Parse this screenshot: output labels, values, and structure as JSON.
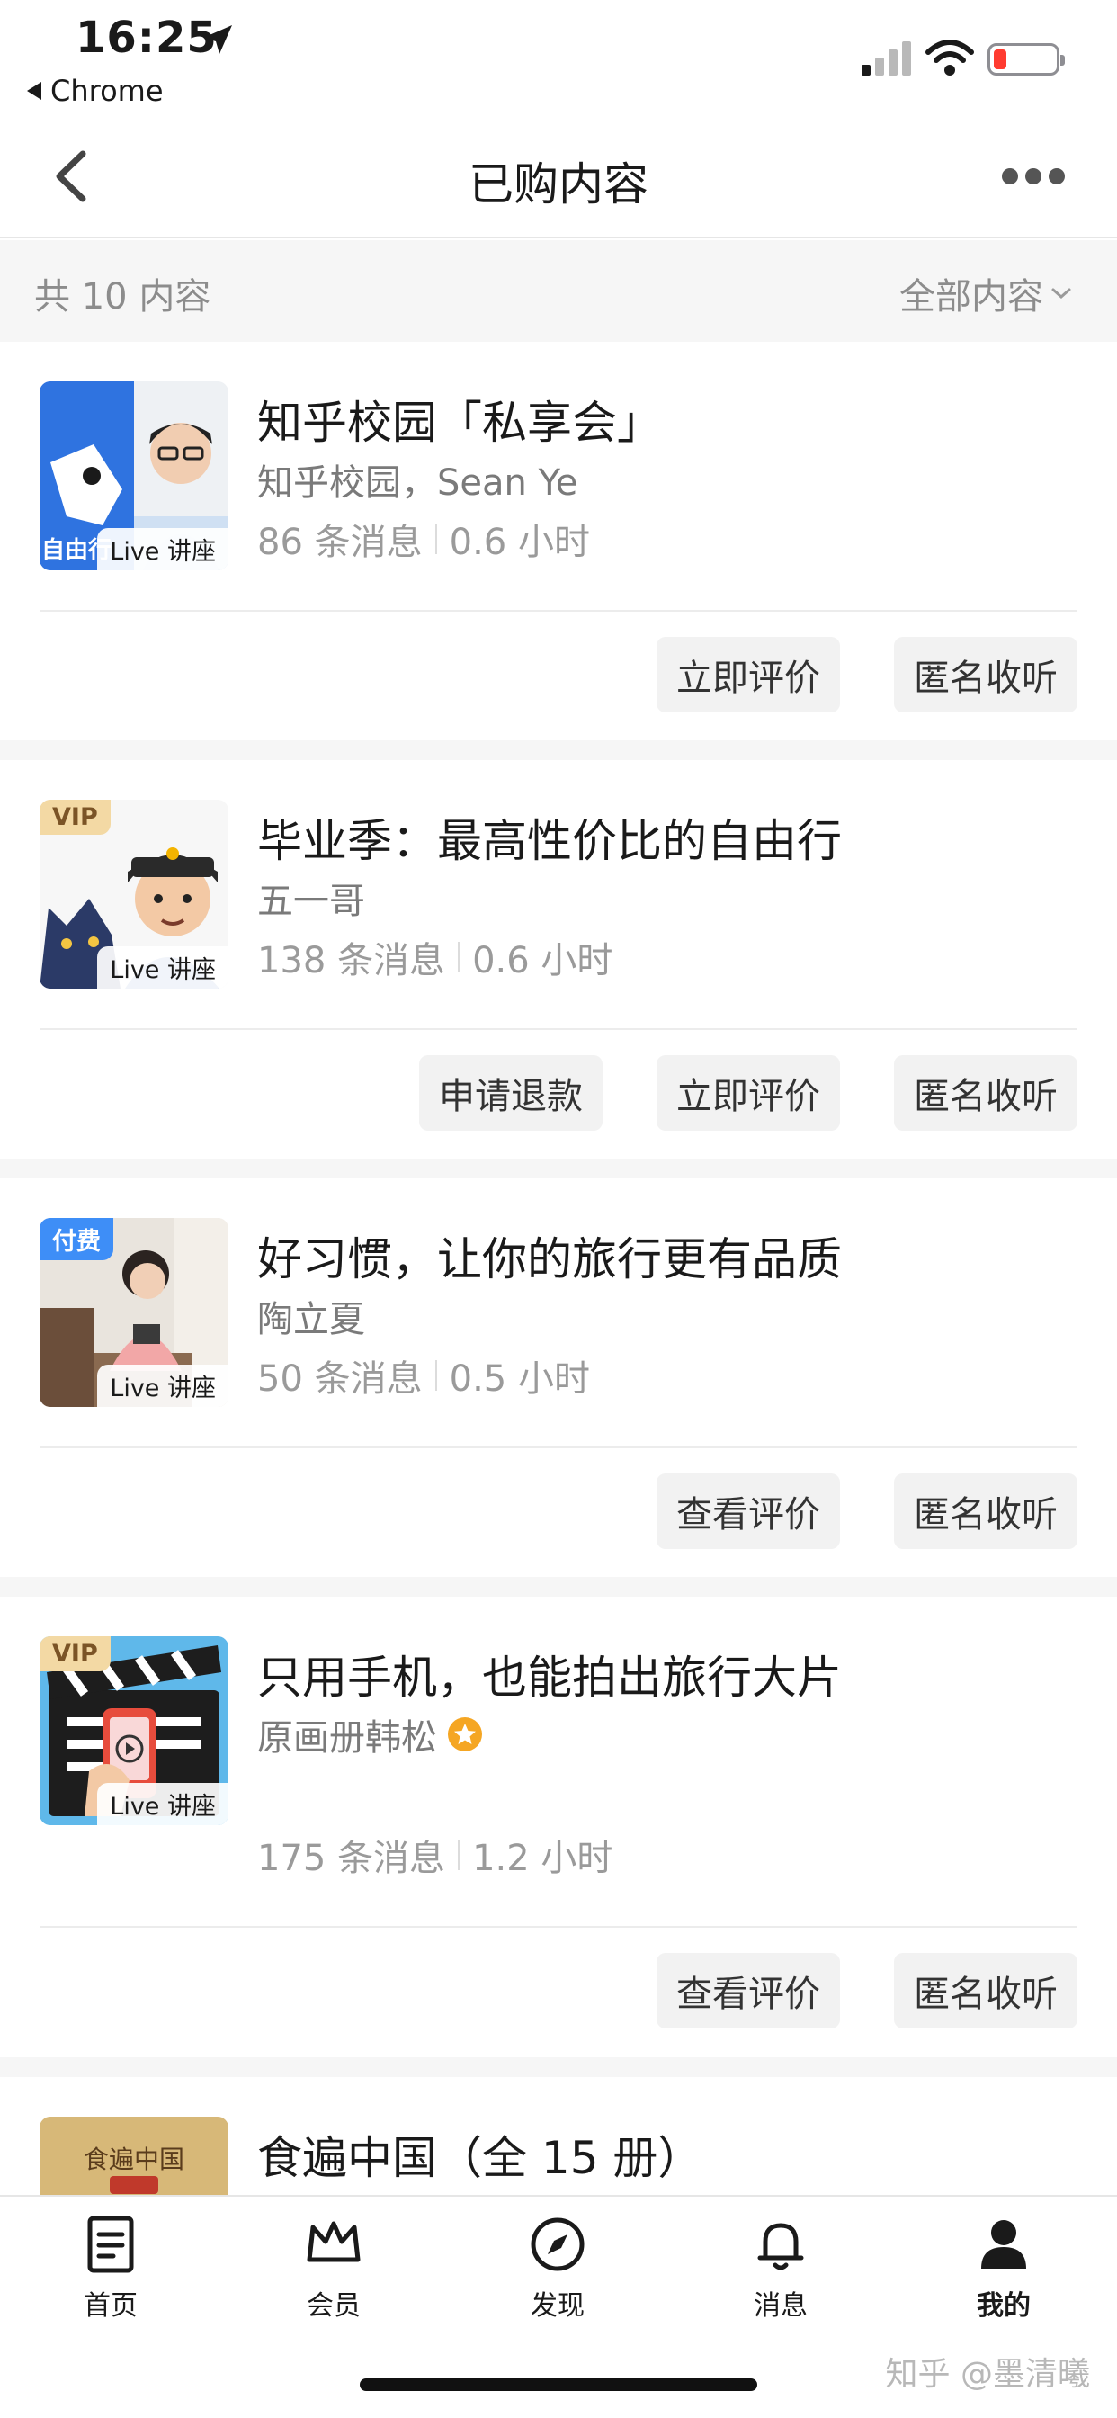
{
  "status_bar": {
    "time": "16:25",
    "back_app": "Chrome"
  },
  "nav": {
    "title": "已购内容"
  },
  "filter": {
    "count_label": "共 10 内容",
    "dropdown_label": "全部内容"
  },
  "live_tag": "Live 讲座",
  "cards": [
    {
      "title": "知乎校园「私享会」",
      "author": "知乎校园，Sean Ye",
      "messages": "86 条消息",
      "duration": "0.6 小时",
      "badge": "",
      "cover_text": "自由行",
      "actions": [
        "立即评价",
        "匿名收听"
      ]
    },
    {
      "title": "毕业季：最高性价比的自由行",
      "author": "五一哥",
      "messages": "138 条消息",
      "duration": "0.6 小时",
      "badge": "VIP",
      "actions": [
        "申请退款",
        "立即评价",
        "匿名收听"
      ]
    },
    {
      "title": "好习惯，让你的旅行更有品质",
      "author": "陶立夏",
      "messages": "50 条消息",
      "duration": "0.5 小时",
      "badge": "付费",
      "actions": [
        "查看评价",
        "匿名收听"
      ]
    },
    {
      "title": "只用手机，也能拍出旅行大片",
      "author": "原画册韩松",
      "messages": "175 条消息",
      "duration": "1.2 小时",
      "badge": "VIP",
      "actions": [
        "查看评价",
        "匿名收听"
      ]
    }
  ],
  "partial_card": {
    "title": "食遍中国（全 15 册）",
    "cover_text": "食遍中国"
  },
  "tabs": [
    {
      "label": "首页",
      "icon": "document-icon"
    },
    {
      "label": "会员",
      "icon": "crown-icon"
    },
    {
      "label": "发现",
      "icon": "compass-icon"
    },
    {
      "label": "消息",
      "icon": "bell-icon"
    },
    {
      "label": "我的",
      "icon": "person-icon"
    }
  ],
  "watermark": "知乎 @墨清曦",
  "colors": {
    "accent_vip": "#f3d9a4",
    "accent_paid": "#3e8ef7",
    "battery_low": "#ff3b30",
    "verified_star": "#f5a623"
  }
}
